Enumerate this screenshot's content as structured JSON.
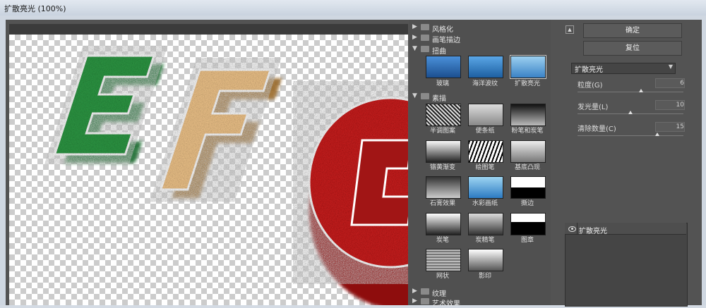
{
  "window": {
    "title": "扩散亮光 (100%)"
  },
  "gallery": {
    "categories": [
      {
        "label": "风格化",
        "expanded": false
      },
      {
        "label": "画笔描边",
        "expanded": false
      },
      {
        "label": "扭曲",
        "expanded": true,
        "items": [
          "玻璃",
          "海洋波纹",
          "扩散亮光"
        ],
        "selected": "扩散亮光"
      },
      {
        "label": "素描",
        "expanded": true,
        "items": [
          "半调图案",
          "便条纸",
          "粉笔和炭笔",
          "铬黄渐变",
          "绘图笔",
          "基底凸现",
          "石膏效果",
          "水彩画纸",
          "撕边",
          "炭笔",
          "炭精笔",
          "图章",
          "网状",
          "影印"
        ]
      },
      {
        "label": "纹理",
        "expanded": false
      },
      {
        "label": "艺术效果",
        "expanded": false
      }
    ]
  },
  "panel": {
    "ok_label": "确定",
    "reset_label": "复位",
    "filter_select": "扩散亮光",
    "params": [
      {
        "label": "粒度(G)",
        "value": "6",
        "max": 10
      },
      {
        "label": "发光量(L)",
        "value": "10",
        "max": 20
      },
      {
        "label": "清除数量(C)",
        "value": "15",
        "max": 20
      }
    ],
    "layer": {
      "label": "扩散亮光"
    }
  },
  "preview": {
    "letters": [
      "E",
      "F",
      "G"
    ]
  },
  "colors": {
    "dialog_bg": "#535353",
    "green": "#2e8b3e",
    "tan": "#d9a15a",
    "red": "#c81a1a"
  }
}
